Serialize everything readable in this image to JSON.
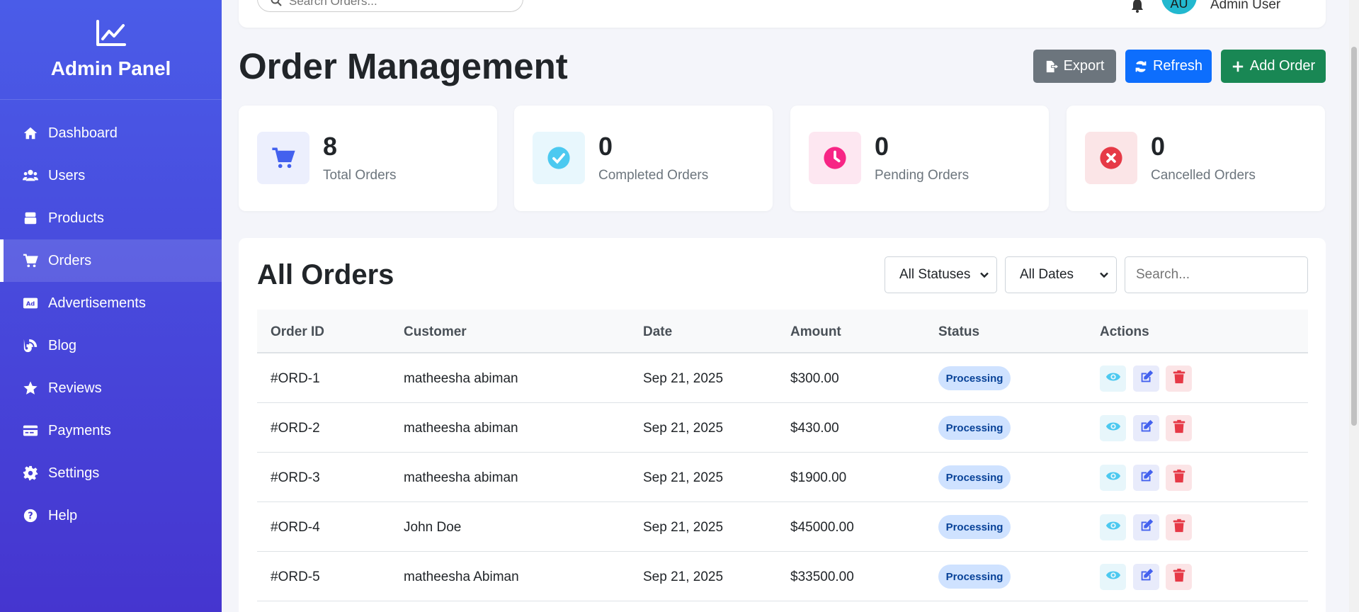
{
  "sidebar": {
    "title": "Admin Panel",
    "items": [
      {
        "label": "Dashboard",
        "icon": "home-icon"
      },
      {
        "label": "Users",
        "icon": "users-icon"
      },
      {
        "label": "Products",
        "icon": "box-icon"
      },
      {
        "label": "Orders",
        "icon": "cart-icon",
        "active": true
      },
      {
        "label": "Advertisements",
        "icon": "ad-icon"
      },
      {
        "label": "Blog",
        "icon": "blog-icon"
      },
      {
        "label": "Reviews",
        "icon": "star-icon"
      },
      {
        "label": "Payments",
        "icon": "credit-card-icon"
      },
      {
        "label": "Settings",
        "icon": "gear-icon"
      },
      {
        "label": "Help",
        "icon": "help-icon"
      }
    ]
  },
  "topbar": {
    "search_placeholder": "Search Orders...",
    "avatar_initials": "AU",
    "username": "Admin User"
  },
  "header": {
    "title": "Order Management",
    "export_label": "Export",
    "refresh_label": "Refresh",
    "add_label": "Add Order"
  },
  "stats": [
    {
      "value": "8",
      "label": "Total Orders",
      "color": "#4361ee"
    },
    {
      "value": "0",
      "label": "Completed Orders",
      "color": "#4cc9f0"
    },
    {
      "value": "0",
      "label": "Pending Orders",
      "color": "#f72585"
    },
    {
      "value": "0",
      "label": "Cancelled Orders",
      "color": "#e63946"
    }
  ],
  "orders": {
    "title": "All Orders",
    "status_filter": "All Statuses",
    "date_filter": "All Dates",
    "search_placeholder": "Search...",
    "columns": [
      "Order ID",
      "Customer",
      "Date",
      "Amount",
      "Status",
      "Actions"
    ],
    "rows": [
      {
        "id": "#ORD-1",
        "customer": "matheesha abiman",
        "date": "Sep 21, 2025",
        "amount": "$300.00",
        "status": "Processing"
      },
      {
        "id": "#ORD-2",
        "customer": "matheesha abiman",
        "date": "Sep 21, 2025",
        "amount": "$430.00",
        "status": "Processing"
      },
      {
        "id": "#ORD-3",
        "customer": "matheesha abiman",
        "date": "Sep 21, 2025",
        "amount": "$1900.00",
        "status": "Processing"
      },
      {
        "id": "#ORD-4",
        "customer": "John Doe",
        "date": "Sep 21, 2025",
        "amount": "$45000.00",
        "status": "Processing"
      },
      {
        "id": "#ORD-5",
        "customer": "matheesha Abiman",
        "date": "Sep 21, 2025",
        "amount": "$33500.00",
        "status": "Processing"
      }
    ]
  }
}
